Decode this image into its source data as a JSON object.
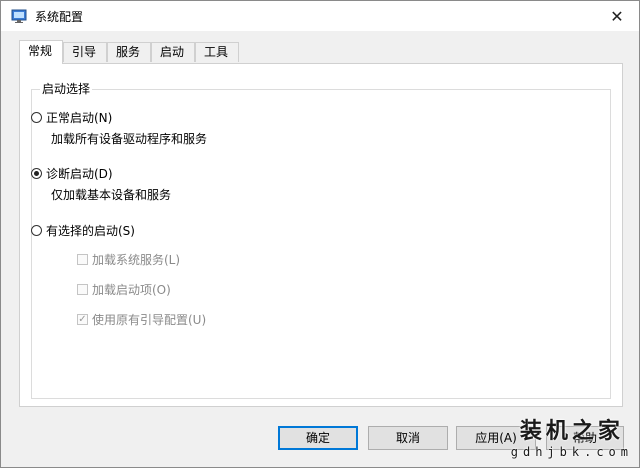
{
  "window": {
    "title": "系统配置",
    "close_glyph": "✕"
  },
  "tabs": [
    {
      "label": "常规",
      "active": true
    },
    {
      "label": "引导",
      "active": false
    },
    {
      "label": "服务",
      "active": false
    },
    {
      "label": "启动",
      "active": false
    },
    {
      "label": "工具",
      "active": false
    }
  ],
  "startup_selection": {
    "legend": "启动选择",
    "options": [
      {
        "label": "正常启动(N)",
        "description": "加载所有设备驱动程序和服务",
        "checked": false
      },
      {
        "label": "诊断启动(D)",
        "description": "仅加载基本设备和服务",
        "checked": true
      },
      {
        "label": "有选择的启动(S)",
        "checked": false
      }
    ],
    "selective_items": [
      {
        "label": "加载系统服务(L)",
        "checked": false,
        "enabled": false
      },
      {
        "label": "加载启动项(O)",
        "checked": false,
        "enabled": false
      },
      {
        "label": "使用原有引导配置(U)",
        "checked": true,
        "enabled": false
      }
    ]
  },
  "buttons": {
    "ok": "确定",
    "cancel": "取消",
    "apply": "应用(A)",
    "help": "帮助"
  },
  "watermark": {
    "title": "装机之家",
    "url": "gdhjbk.com"
  },
  "colors": {
    "accent": "#0078d7",
    "desktop": "#1f5f9e"
  }
}
